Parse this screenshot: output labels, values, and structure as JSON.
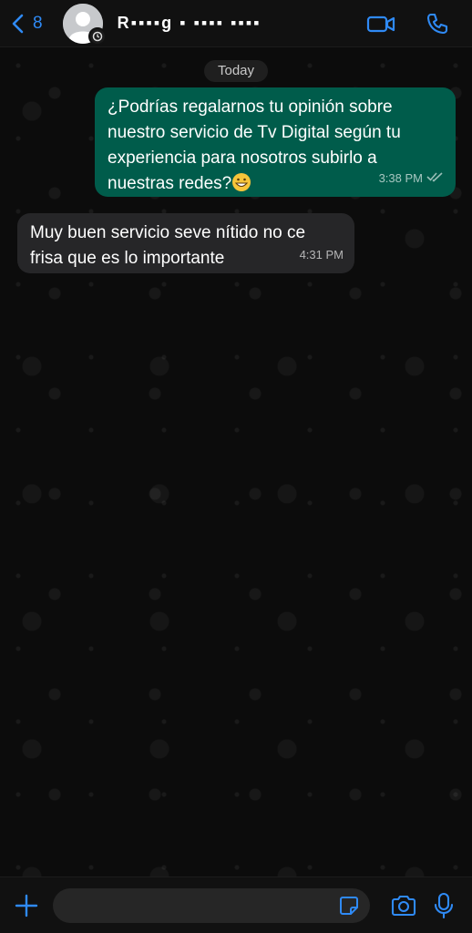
{
  "header": {
    "back_count": "8",
    "contact_name": "R▪▪▪▪g  ▪  ▪▪▪▪  ▪▪▪▪"
  },
  "date_separator": "Today",
  "messages": [
    {
      "direction": "outgoing",
      "text": "¿Podrías regalarnos tu opinión sobre nuestro servicio de Tv Digital según tu experiencia para nosotros subirlo a nuestras redes?",
      "emoji": "grinning-face-icon",
      "time": "3:38 PM",
      "status": "read"
    },
    {
      "direction": "incoming",
      "text": "Muy buen servicio seve nítido no ce frisa que es lo importante",
      "time": "4:31 PM"
    }
  ],
  "composer": {
    "value": "",
    "placeholder": ""
  },
  "colors": {
    "accent": "#2f8af5",
    "outgoing_bubble": "#005c4b",
    "incoming_bubble": "#262628",
    "background": "#0c0c0c"
  }
}
